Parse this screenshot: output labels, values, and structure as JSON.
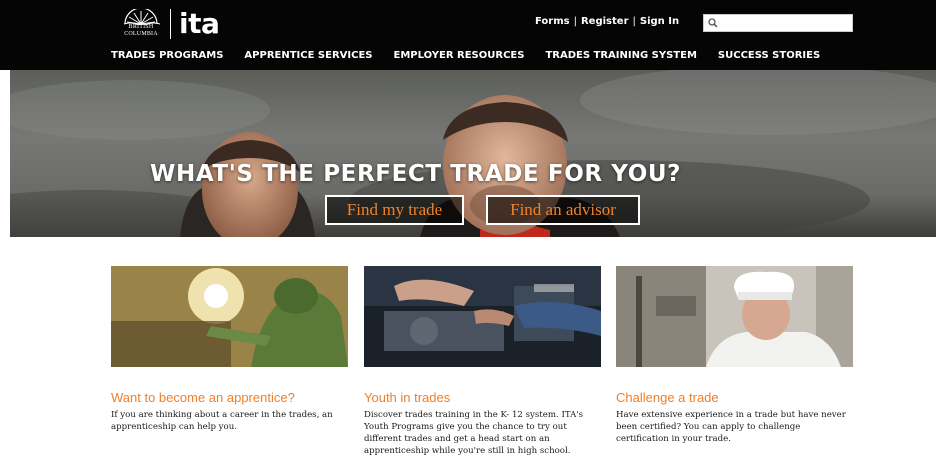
{
  "header": {
    "logo": {
      "province_text": "BRITISH COLUMBIA",
      "brand": "ita"
    },
    "top_links": [
      "Forms",
      "Register",
      "Sign In"
    ],
    "separator": "|",
    "search": {
      "placeholder": "",
      "value": ""
    },
    "nav": [
      "TRADES PROGRAMS",
      "APPRENTICE SERVICES",
      "EMPLOYER RESOURCES",
      "TRADES TRAINING SYSTEM",
      "SUCCESS STORIES"
    ]
  },
  "hero": {
    "title": "WHAT'S THE PERFECT TRADE FOR YOU?",
    "buttons": [
      "Find my trade",
      "Find an advisor"
    ]
  },
  "cards": [
    {
      "title": "Want to become an apprentice?",
      "text": "If you are thinking about a career in the trades, an apprenticeship can help you."
    },
    {
      "title": "Youth in trades",
      "text": "Discover trades training in the K- 12 system. ITA's Youth Programs give you the chance to try out different trades and get a head start on an apprenticeship while you're still in high school."
    },
    {
      "title": "Challenge a trade",
      "text": "Have extensive experience in a trade but have never been certified? You can apply to challenge certification in your trade."
    }
  ],
  "colors": {
    "header_bg": "#050505",
    "accent": "#ef7f2a",
    "button_text": "#f0822a"
  },
  "icons": {
    "search": "search-icon"
  }
}
